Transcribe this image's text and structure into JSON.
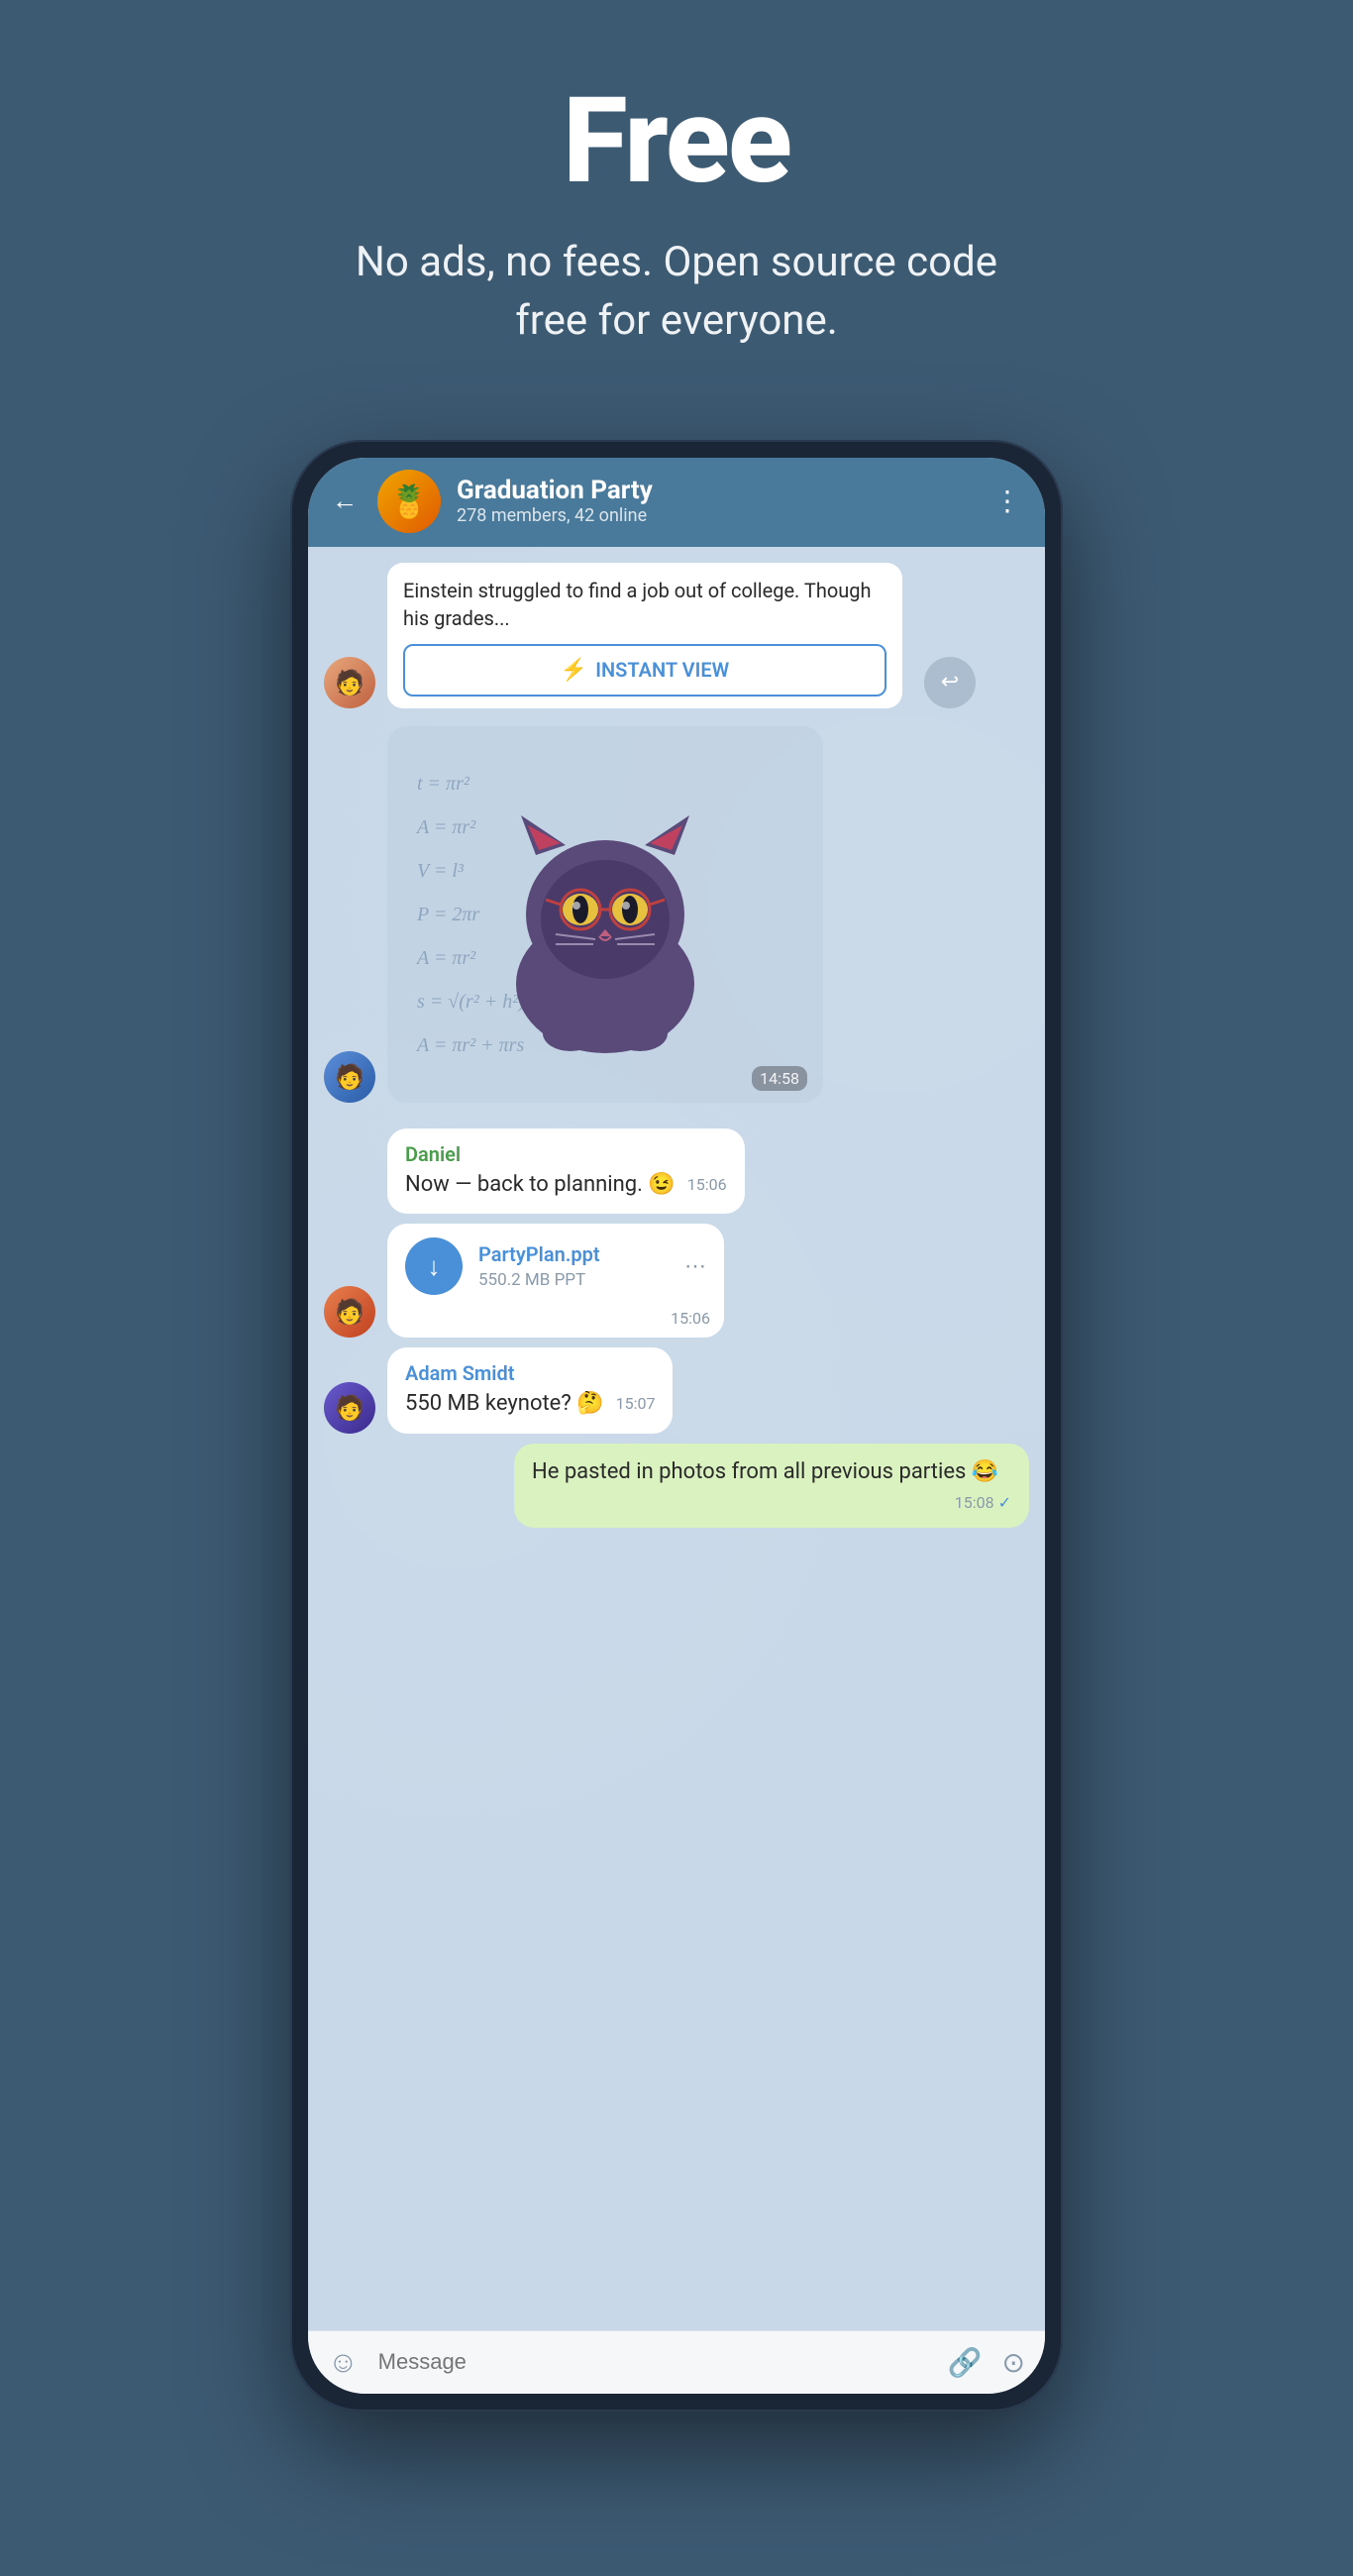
{
  "hero": {
    "title": "Free",
    "subtitle": "No ads, no fees. Open source code free for everyone."
  },
  "chat": {
    "back_label": "←",
    "group_name": "Graduation Party",
    "group_members": "278 members, 42 online",
    "menu_dots": "⋮",
    "messages": [
      {
        "id": "article-msg",
        "type": "article",
        "text": "Einstein struggled to find a job out of college. Though his grades...",
        "instant_view_label": "INSTANT VIEW"
      },
      {
        "id": "sticker-msg",
        "type": "sticker",
        "time": "14:58"
      },
      {
        "id": "daniel-msg",
        "type": "received",
        "sender": "Daniel",
        "sender_color": "daniel",
        "text": "Now — back to planning. 😉",
        "time": "15:06"
      },
      {
        "id": "file-msg",
        "type": "file",
        "file_name": "PartyPlan.ppt",
        "file_size": "550.2 MB PPT",
        "time": "15:06"
      },
      {
        "id": "adam-msg",
        "type": "received",
        "sender": "Adam Smidt",
        "sender_color": "adam",
        "text": "550 MB keynote? 🤔",
        "time": "15:07"
      },
      {
        "id": "outgoing-msg",
        "type": "outgoing",
        "text": "He pasted in photos from all previous parties 😂",
        "time": "15:08",
        "check": "✓"
      }
    ],
    "input": {
      "placeholder": "Message",
      "emoji_icon": "☺",
      "attach_icon": "📎",
      "camera_icon": "⊙"
    }
  }
}
